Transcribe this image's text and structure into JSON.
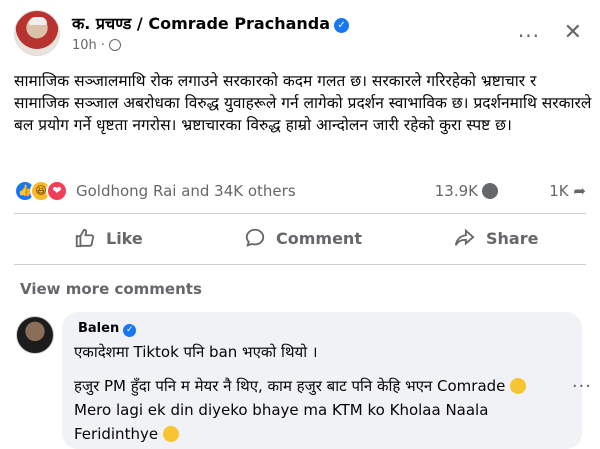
{
  "post": {
    "author": "क. प्रचण्ड / Comrade Prachanda",
    "time": "10h ·",
    "more_icon": "ellipsis-icon",
    "close_icon": "close-icon",
    "text": "सामाजिक सञ्जालमाथि रोक लगाउने सरकारको कदम गलत छ। सरकारले गरिरहेको भ्रष्टाचार र सामाजिक सञ्जाल अबरोधका विरुद्ध युवाहरूले गर्न लागेको प्रदर्शन स्वाभाविक छ। प्रदर्शनमाथि सरकारले बल प्रयोग गर्ने धृष्टता नगरोस। भ्रष्टाचारका विरुद्ध हाम्रो आन्दोलन जारी रहेको कुरा स्पष्ट छ।"
  },
  "reactions": {
    "names": "Goldhong Rai and 34K others",
    "comments": "13.9K",
    "shares": "1K"
  },
  "actions": {
    "like": "Like",
    "comment": "Comment",
    "share": "Share"
  },
  "comments": {
    "view_more": "View more comments",
    "items": [
      {
        "name": "Balen",
        "line1": "एकादेशमा Tiktok पनि ban भएको थियो ।",
        "line2a": "हजुर PM हुँदा पनि म मेयर नै थिए, काम हजुर बाट पनि केहि भएन Comrade",
        "line2b": "Mero lagi ek din diyeko bhaye ma KTM ko Kholaa Naala Feridinthye"
      }
    ]
  },
  "colors": {
    "accent": "#1877f2",
    "muted": "#65676b",
    "bubble": "#f0f2f5"
  }
}
